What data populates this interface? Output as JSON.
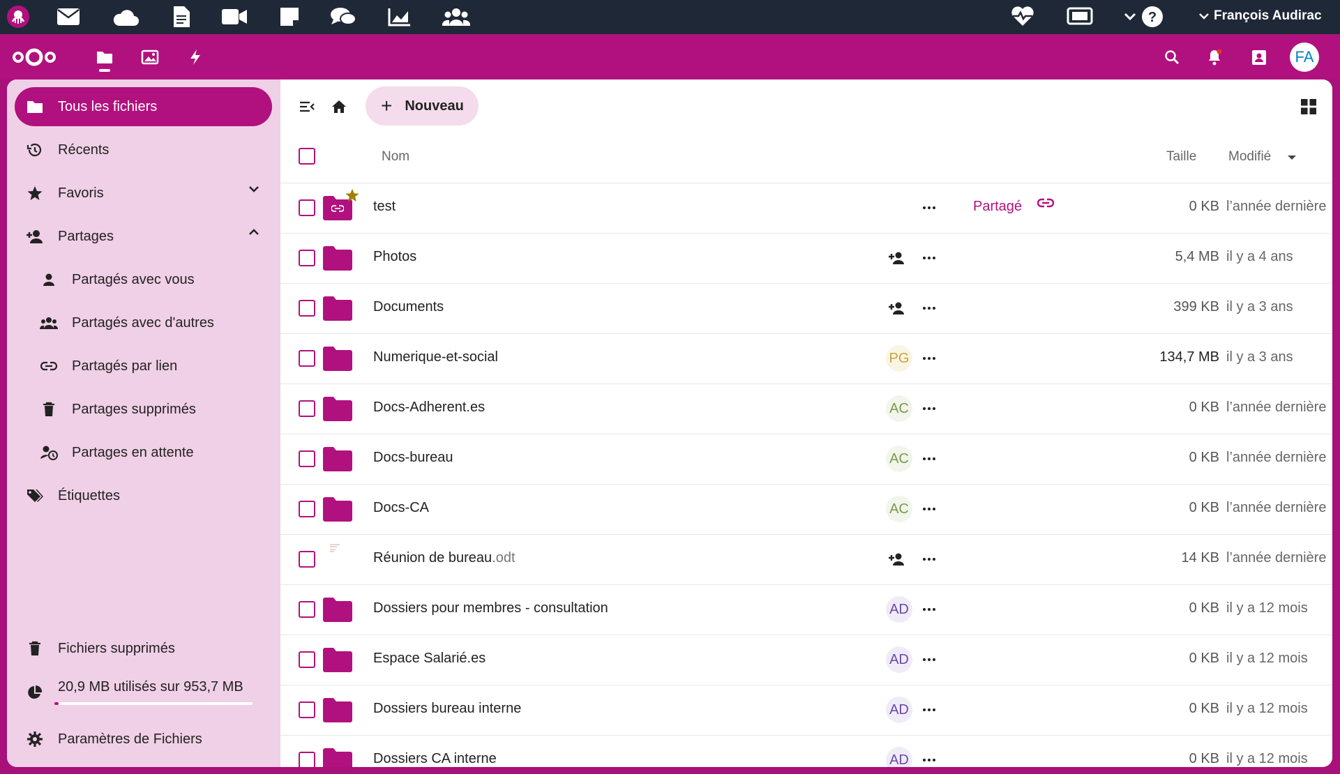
{
  "system_bar": {
    "apps": [
      "octopus-logo-icon",
      "mail-icon",
      "cloud-icon",
      "document-icon",
      "video-icon",
      "note-icon",
      "chat-icon",
      "chart-icon",
      "group-icon"
    ],
    "right_icons": [
      "heartbeat-icon",
      "screen-icon",
      "chevron-down-icon",
      "help-icon"
    ],
    "user_name": "François Audirac"
  },
  "header": {
    "apps": [
      "files-icon",
      "photos-icon",
      "activity-icon"
    ],
    "right_icons": [
      "search-icon",
      "notifications-icon",
      "contacts-icon"
    ],
    "avatar_initials": "FA"
  },
  "sidebar": {
    "items": [
      {
        "label": "Tous les fichiers",
        "icon": "folder-icon",
        "active": true
      },
      {
        "label": "Récents",
        "icon": "history-icon"
      },
      {
        "label": "Favoris",
        "icon": "star-icon",
        "chevron": "down"
      },
      {
        "label": "Partages",
        "icon": "account-plus-icon",
        "chevron": "up"
      },
      {
        "label": "Partagés avec vous",
        "icon": "person-icon",
        "sub": true
      },
      {
        "label": "Partagés avec d'autres",
        "icon": "people-icon",
        "sub": true
      },
      {
        "label": "Partagés par lien",
        "icon": "link-icon",
        "sub": true
      },
      {
        "label": "Partages supprimés",
        "icon": "trash-icon",
        "sub": true
      },
      {
        "label": "Partages en attente",
        "icon": "account-clock-icon",
        "sub": true
      },
      {
        "label": "Étiquettes",
        "icon": "tag-icon"
      }
    ],
    "deleted_files": "Fichiers supprimés",
    "quota": "20,9 MB utilisés sur 953,7 MB",
    "quota_fraction": 0.022,
    "settings": "Paramètres de Fichiers"
  },
  "toolbar": {
    "new_label": "Nouveau"
  },
  "table": {
    "col_name": "Nom",
    "col_size": "Taille",
    "col_modified": "Modifié",
    "rows": [
      {
        "name": "test",
        "ext": "",
        "type": "folder-shared",
        "favorite": true,
        "share_label": "Partagé",
        "size": "0 KB",
        "modified": "l’année dernière"
      },
      {
        "name": "Photos",
        "ext": "",
        "type": "folder",
        "share": "add",
        "size": "5,4 MB",
        "modified": "il y a 4 ans"
      },
      {
        "name": "Documents",
        "ext": "",
        "type": "folder",
        "share": "add",
        "size": "399 KB",
        "modified": "il y a 3 ans"
      },
      {
        "name": "Numerique-et-social",
        "ext": "",
        "type": "folder",
        "share_avatar": "PG",
        "size": "134,7 MB",
        "modified": "il y a 3 ans",
        "big": true
      },
      {
        "name": "Docs-Adherent.es",
        "ext": "",
        "type": "folder",
        "share_avatar": "AC",
        "size": "0 KB",
        "modified": "l’année dernière"
      },
      {
        "name": "Docs-bureau",
        "ext": "",
        "type": "folder",
        "share_avatar": "AC",
        "size": "0 KB",
        "modified": "l’année dernière"
      },
      {
        "name": "Docs-CA",
        "ext": "",
        "type": "folder",
        "share_avatar": "AC",
        "size": "0 KB",
        "modified": "l’année dernière"
      },
      {
        "name": "Réunion de bureau",
        "ext": ".odt",
        "type": "document",
        "share": "add",
        "size": "14 KB",
        "modified": "l’année dernière"
      },
      {
        "name": "Dossiers pour membres - consultation",
        "ext": "",
        "type": "folder",
        "share_avatar": "AD",
        "size": "0 KB",
        "modified": "il y a 12 mois"
      },
      {
        "name": "Espace Salarié.es",
        "ext": "",
        "type": "folder",
        "share_avatar": "AD",
        "size": "0 KB",
        "modified": "il y a 12 mois"
      },
      {
        "name": "Dossiers bureau interne",
        "ext": "",
        "type": "folder",
        "share_avatar": "AD",
        "size": "0 KB",
        "modified": "il y a 12 mois"
      },
      {
        "name": "Dossiers CA interne",
        "ext": "",
        "type": "folder",
        "share_avatar": "AD",
        "size": "0 KB",
        "modified": "il y a 12 mois"
      }
    ]
  },
  "colors": {
    "brand": "#b1117e",
    "sidebar_bg": "#f0d0e6",
    "topbar": "#1f2836",
    "star": "#a08000"
  }
}
